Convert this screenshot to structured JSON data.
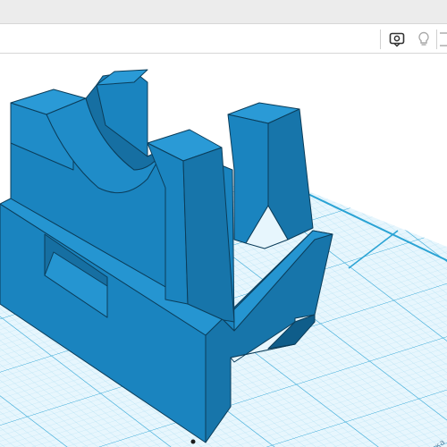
{
  "toolbar": {
    "buttons": [
      {
        "name": "view-icon",
        "active": true
      },
      {
        "name": "light-bulb-icon",
        "active": false
      },
      {
        "name": "panel-icon",
        "active": false
      }
    ]
  },
  "workplane": {
    "grid_label": "Сетка",
    "grid_color": "#2aa3d4",
    "plane_color": "#e7f6fd"
  },
  "model": {
    "color_front": "#1a84bf",
    "color_top": "#2595d1",
    "color_side": "#1775aa",
    "color_dark": "#105a85",
    "edge_color": "#0b3d5a"
  }
}
